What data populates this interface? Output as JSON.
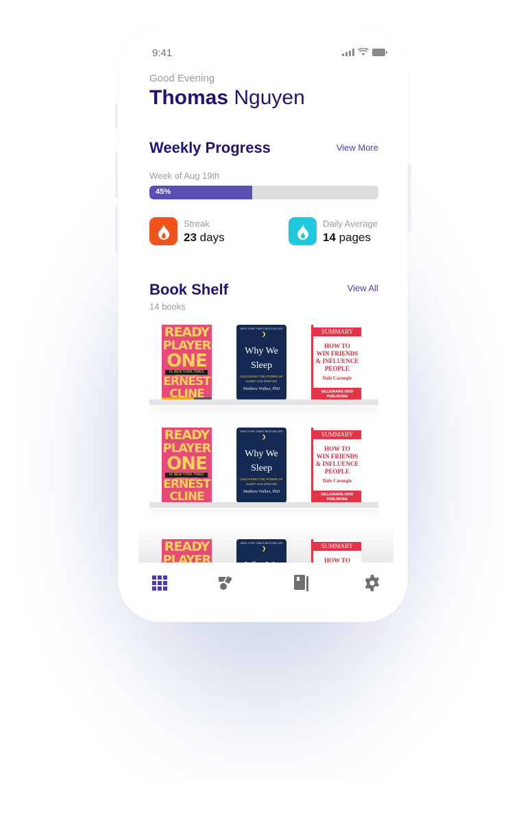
{
  "status": {
    "time": "9:41"
  },
  "header": {
    "greeting": "Good Evening",
    "first_name": "Thomas",
    "last_name": "Nguyen"
  },
  "weekly": {
    "title": "Weekly Progress",
    "view_more": "View More",
    "week_label": "Week of Aug 19th",
    "progress_fraction": 0.45,
    "progress_label": "45%",
    "streak": {
      "label": "Streak",
      "value": "23",
      "unit": "days",
      "color": "#f0531c"
    },
    "daily_average": {
      "label": "Daily Average",
      "value": "14",
      "unit": "pages",
      "color": "#1ec8de"
    }
  },
  "shelf": {
    "title": "Book Shelf",
    "view_all": "View All",
    "count": "14 books",
    "books": {
      "ready_player_one": {
        "lines": [
          "READY",
          "PLAYER",
          "ONE",
          "ERNEST",
          "CLINE"
        ],
        "badge": "#1 NEW YORK TIMES BESTSELLER"
      },
      "why_we_sleep": {
        "top": "NEW YORK TIMES BESTSELLER",
        "title_1": "Why We",
        "title_2": "Sleep",
        "sub_1": "UNLOCKING THE POWER OF",
        "sub_2": "SLEEP AND DREAMS",
        "author": "Matthew Walker, PhD"
      },
      "how_to_win": {
        "badge": "SUMMARY",
        "title_1": "HOW TO",
        "title_2": "WIN FRIENDS",
        "title_3": "& INFLUENCE",
        "title_4": "PEOPLE",
        "author": "Dale Carnegie",
        "publisher_1": "MILLIONAIRE MIND",
        "publisher_2": "PUBLISHING"
      }
    }
  },
  "tabbar": {
    "items": [
      {
        "icon": "grid-icon",
        "active": true,
        "color": "#4b3bb3"
      },
      {
        "icon": "goals-icon",
        "active": false,
        "color": "#6f6f6f"
      },
      {
        "icon": "book-icon",
        "active": false,
        "color": "#6f6f6f"
      },
      {
        "icon": "gear-icon",
        "active": false,
        "color": "#6f6f6f"
      }
    ]
  },
  "colors": {
    "accent": "#1f1575",
    "link": "#4b3bb3",
    "progress": "#5b4fb3"
  }
}
